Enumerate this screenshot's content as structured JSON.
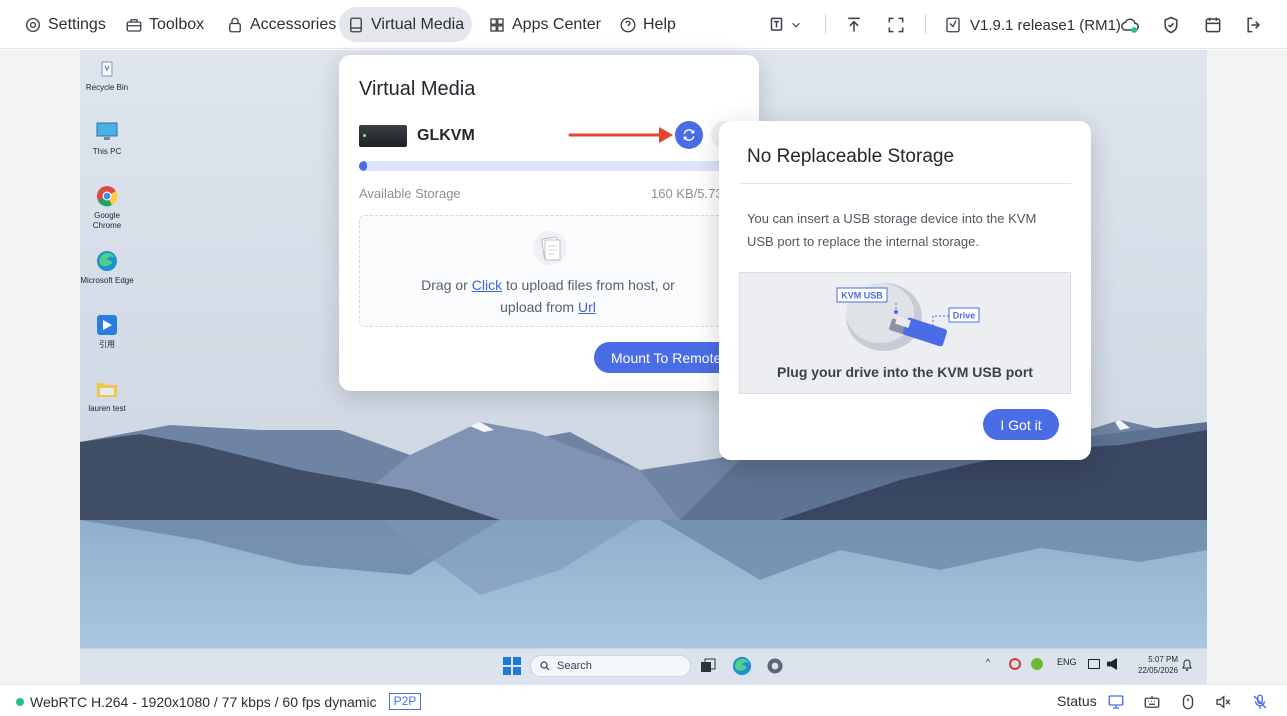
{
  "nav": {
    "items": [
      {
        "label": "Settings",
        "icon": "gear-icon",
        "active": false
      },
      {
        "label": "Toolbox",
        "icon": "toolbox-icon",
        "active": false
      },
      {
        "label": "Accessories",
        "icon": "lock-icon",
        "active": false
      },
      {
        "label": "Virtual Media",
        "icon": "drive-icon",
        "active": true
      },
      {
        "label": "Apps Center",
        "icon": "apps-icon",
        "active": false
      },
      {
        "label": "Help",
        "icon": "help-icon",
        "active": false
      }
    ],
    "version": "V1.9.1 release1 (RM1)",
    "colors": {
      "active_bg": "#e4e7ec",
      "accent": "#4a6de5",
      "online": "#23c18d"
    }
  },
  "desktop": {
    "icons": [
      {
        "label": "Recycle Bin",
        "icon": "recycle-bin-icon"
      },
      {
        "label": "This PC",
        "icon": "monitor-icon"
      },
      {
        "label": "Google Chrome",
        "icon": "chrome-icon"
      },
      {
        "label": "Microsoft Edge",
        "icon": "edge-icon"
      },
      {
        "label": "引用",
        "icon": "shortcut-icon"
      },
      {
        "label": "lauren test",
        "icon": "folder-icon"
      }
    ],
    "taskbar": {
      "search_placeholder": "Search",
      "lang": "ENG",
      "time": "5:07 PM",
      "date": "22/05/2026"
    }
  },
  "virtual_media": {
    "title": "Virtual Media",
    "drive_name": "GLKVM",
    "storage_label": "Available Storage",
    "storage_value": "160 KB/5.73",
    "storage_fraction": 0.01,
    "drop_prefix": "Drag or ",
    "drop_click": "Click",
    "drop_middle": " to upload files from host, or",
    "drop_upload_from": "upload from ",
    "drop_url": "Url",
    "mount_button": "Mount To Remote"
  },
  "popover": {
    "title": "No Replaceable Storage",
    "text": "You can insert a USB storage device into the KVM USB port to replace the internal storage.",
    "label_kvm_usb": "KVM USB",
    "label_drive": "Drive",
    "caption": "Plug your drive into the KVM USB port",
    "confirm_button": "I Got it"
  },
  "statusbar": {
    "stream": "WebRTC H.264 - 1920x1080 /  77 kbps / 60 fps dynamic",
    "p2p": "P2P",
    "status_label": "Status"
  }
}
